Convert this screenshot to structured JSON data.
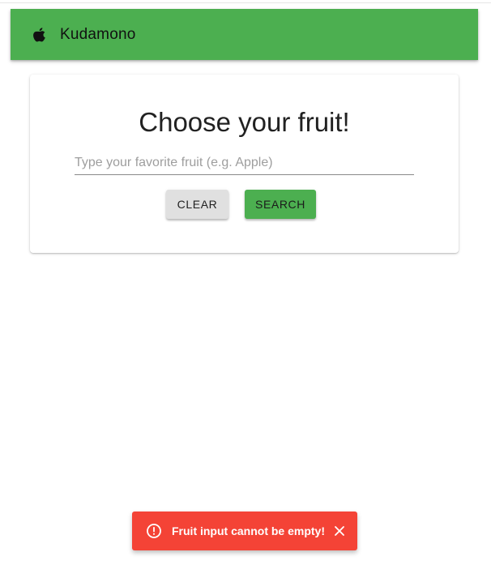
{
  "app_bar": {
    "title": "Kudamono",
    "logo_icon": "apple-icon",
    "background": "#4caf50"
  },
  "card": {
    "heading": "Choose your fruit!",
    "input": {
      "value": "",
      "placeholder": "Type your favorite fruit (e.g. Apple)"
    },
    "buttons": {
      "clear_label": "CLEAR",
      "search_label": "SEARCH"
    }
  },
  "snackbar": {
    "message": "Fruit input cannot be empty!",
    "icon": "alert-circle-icon",
    "close_icon": "close-icon",
    "background": "#f44336"
  }
}
